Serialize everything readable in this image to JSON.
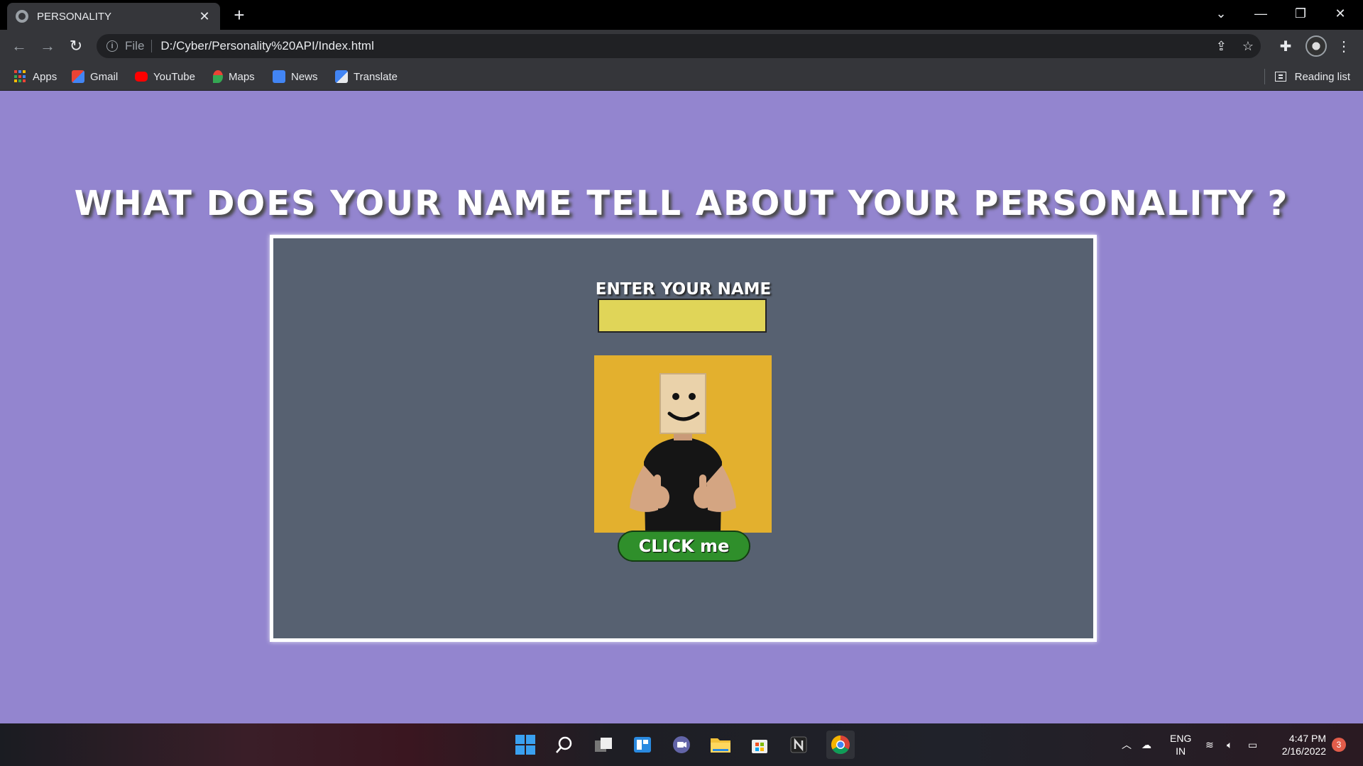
{
  "browser": {
    "tab_title": "PERSONALITY",
    "address_scheme": "File",
    "address_url": "D:/Cyber/Personality%20API/Index.html",
    "bookmarks": [
      {
        "label": "Apps",
        "icon": "apps-grid-icon"
      },
      {
        "label": "Gmail",
        "icon": "gmail-icon"
      },
      {
        "label": "YouTube",
        "icon": "youtube-icon"
      },
      {
        "label": "Maps",
        "icon": "maps-icon"
      },
      {
        "label": "News",
        "icon": "news-icon"
      },
      {
        "label": "Translate",
        "icon": "translate-icon"
      }
    ],
    "reading_list": "Reading list"
  },
  "page": {
    "headline": "WHAT DOES YOUR NAME TELL ABOUT YOUR PERSONALITY ?",
    "input_label": "ENTER YOUR NAME",
    "name_value": "",
    "button_label": "CLICK me",
    "background_color": "#9385cf",
    "card_color": "#576171",
    "input_color": "#e0d558",
    "button_color": "#2f8f2b"
  },
  "taskbar": {
    "lang_line1": "ENG",
    "lang_line2": "IN",
    "time": "4:47 PM",
    "date": "2/16/2022",
    "notification_count": "3"
  }
}
